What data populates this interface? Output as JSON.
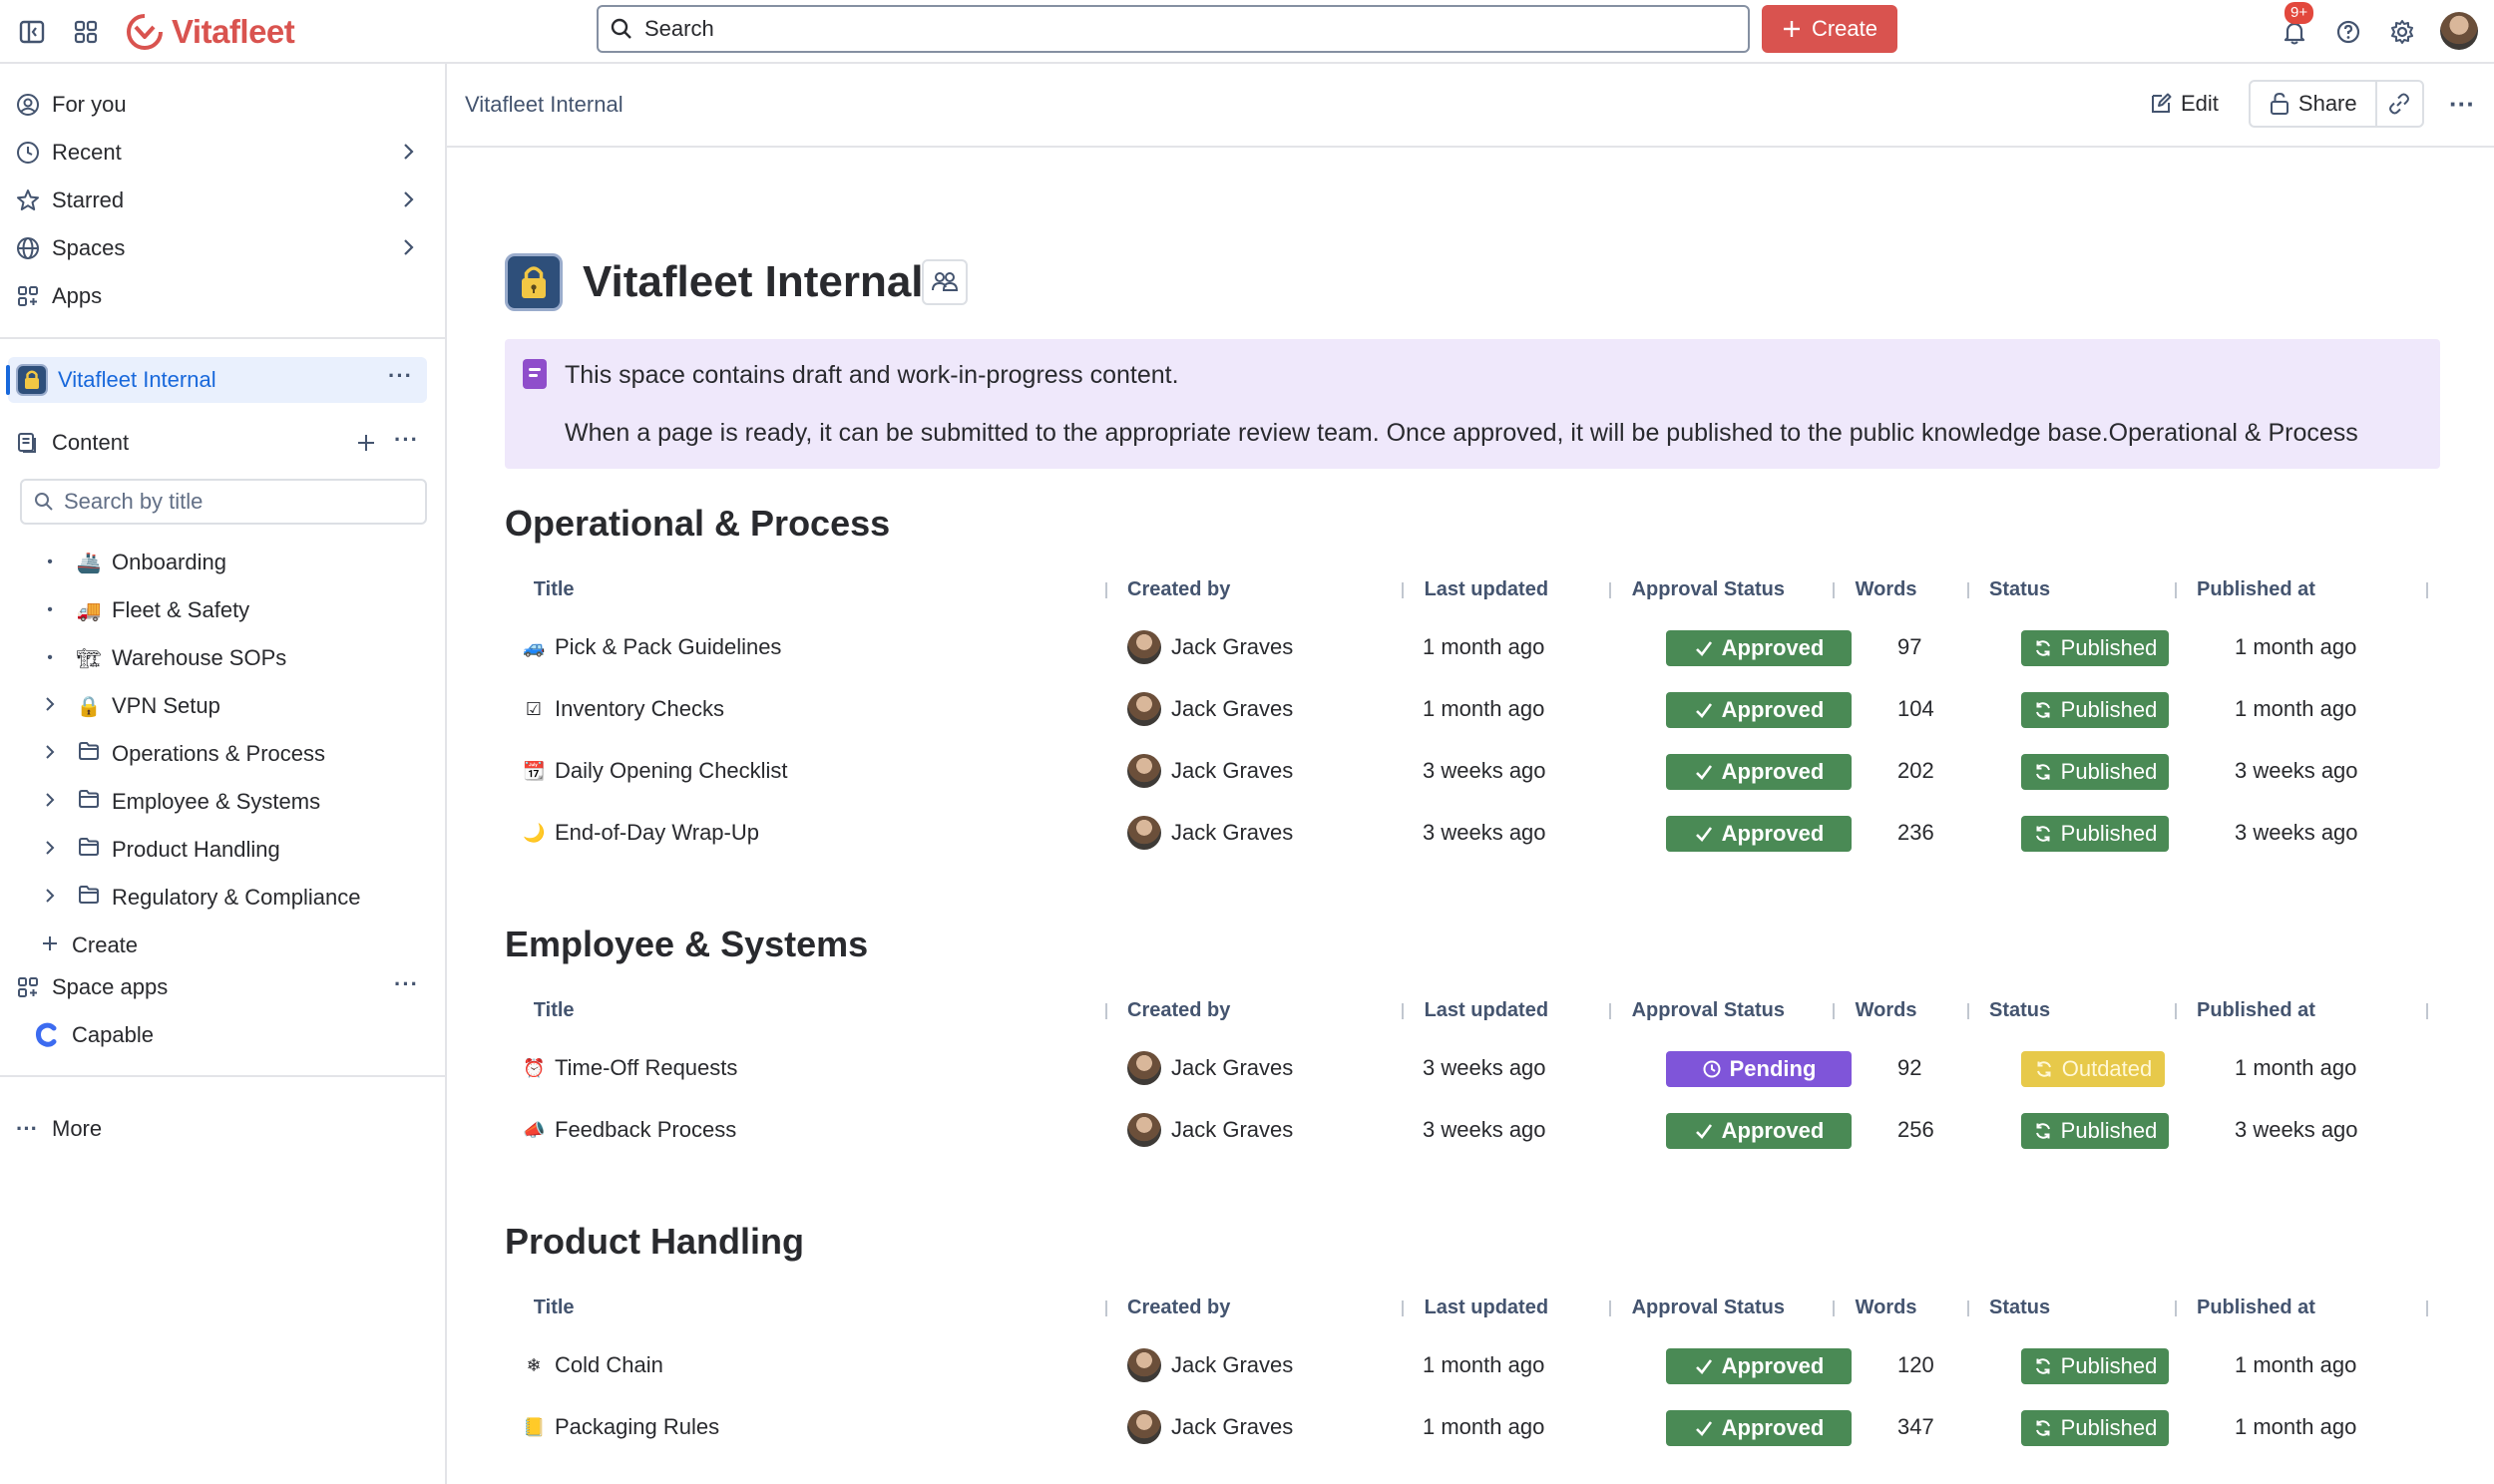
{
  "topbar": {
    "brand": "Vitafleet",
    "search_placeholder": "Search",
    "create_label": "Create",
    "notifications_count": "9+"
  },
  "sidebar": {
    "nav": [
      {
        "label": "For you"
      },
      {
        "label": "Recent"
      },
      {
        "label": "Starred"
      },
      {
        "label": "Spaces"
      },
      {
        "label": "Apps"
      }
    ],
    "space_name": "Vitafleet Internal",
    "content_label": "Content",
    "search_placeholder": "Search by title",
    "tree": [
      {
        "label": "Onboarding",
        "emoji": "🚢",
        "expandable": false
      },
      {
        "label": "Fleet & Safety",
        "emoji": "🚚",
        "expandable": false
      },
      {
        "label": "Warehouse SOPs",
        "emoji": "🏗",
        "expandable": false
      },
      {
        "label": "VPN Setup",
        "emoji": "🔒",
        "expandable": true
      },
      {
        "label": "Operations & Process",
        "emoji": "folder",
        "expandable": true
      },
      {
        "label": "Employee & Systems",
        "emoji": "folder",
        "expandable": true
      },
      {
        "label": "Product Handling",
        "emoji": "folder",
        "expandable": true
      },
      {
        "label": "Regulatory & Compliance",
        "emoji": "folder",
        "expandable": true
      }
    ],
    "create_label": "Create",
    "space_apps_label": "Space apps",
    "capable_label": "Capable",
    "more_label": "More"
  },
  "main": {
    "breadcrumb": "Vitafleet Internal",
    "edit_label": "Edit",
    "share_label": "Share",
    "title": "Vitafleet Internal",
    "panel_line1": "This space contains draft and work-in-progress content.",
    "panel_line2": "When a page is ready, it can be submitted to the appropriate review team. Once approved, it will be published to the public knowledge base.Operational & Process",
    "columns": [
      "Title",
      "Created by",
      "Last updated",
      "Approval Status",
      "Words",
      "Status",
      "Published at"
    ],
    "sections": [
      {
        "heading": "Operational & Process",
        "rows": [
          {
            "emoji": "🚙",
            "title": "Pick & Pack Guidelines",
            "creator": "Jack Graves",
            "updated": "1 month ago",
            "approval": "Approved",
            "words": "97",
            "status": "Published",
            "published": "1 month ago"
          },
          {
            "emoji": "☑",
            "title": "Inventory Checks",
            "creator": "Jack Graves",
            "updated": "1 month ago",
            "approval": "Approved",
            "words": "104",
            "status": "Published",
            "published": "1 month ago"
          },
          {
            "emoji": "📆",
            "title": "Daily Opening Checklist",
            "creator": "Jack Graves",
            "updated": "3 weeks ago",
            "approval": "Approved",
            "words": "202",
            "status": "Published",
            "published": "3 weeks ago"
          },
          {
            "emoji": "🌙",
            "title": "End-of-Day Wrap-Up",
            "creator": "Jack Graves",
            "updated": "3 weeks ago",
            "approval": "Approved",
            "words": "236",
            "status": "Published",
            "published": "3 weeks ago"
          }
        ]
      },
      {
        "heading": "Employee & Systems",
        "rows": [
          {
            "emoji": "⏰",
            "title": "Time-Off Requests",
            "creator": "Jack Graves",
            "updated": "3 weeks ago",
            "approval": "Pending",
            "words": "92",
            "status": "Outdated",
            "published": "1 month ago"
          },
          {
            "emoji": "📣",
            "title": "Feedback Process",
            "creator": "Jack Graves",
            "updated": "3 weeks ago",
            "approval": "Approved",
            "words": "256",
            "status": "Published",
            "published": "3 weeks ago"
          }
        ]
      },
      {
        "heading": "Product Handling",
        "rows": [
          {
            "emoji": "❄",
            "title": "Cold Chain",
            "creator": "Jack Graves",
            "updated": "1 month ago",
            "approval": "Approved",
            "words": "120",
            "status": "Published",
            "published": "1 month ago"
          },
          {
            "emoji": "📒",
            "title": "Packaging Rules",
            "creator": "Jack Graves",
            "updated": "1 month ago",
            "approval": "Approved",
            "words": "347",
            "status": "Published",
            "published": "1 month ago"
          }
        ]
      }
    ]
  },
  "colors": {
    "brand": "#d9534f",
    "approved": "#4a8a55",
    "pending": "#7f55d9",
    "outdated": "#e7c94a",
    "selected_bg": "#e9f0fd",
    "panel_bg": "#efe8fb"
  }
}
